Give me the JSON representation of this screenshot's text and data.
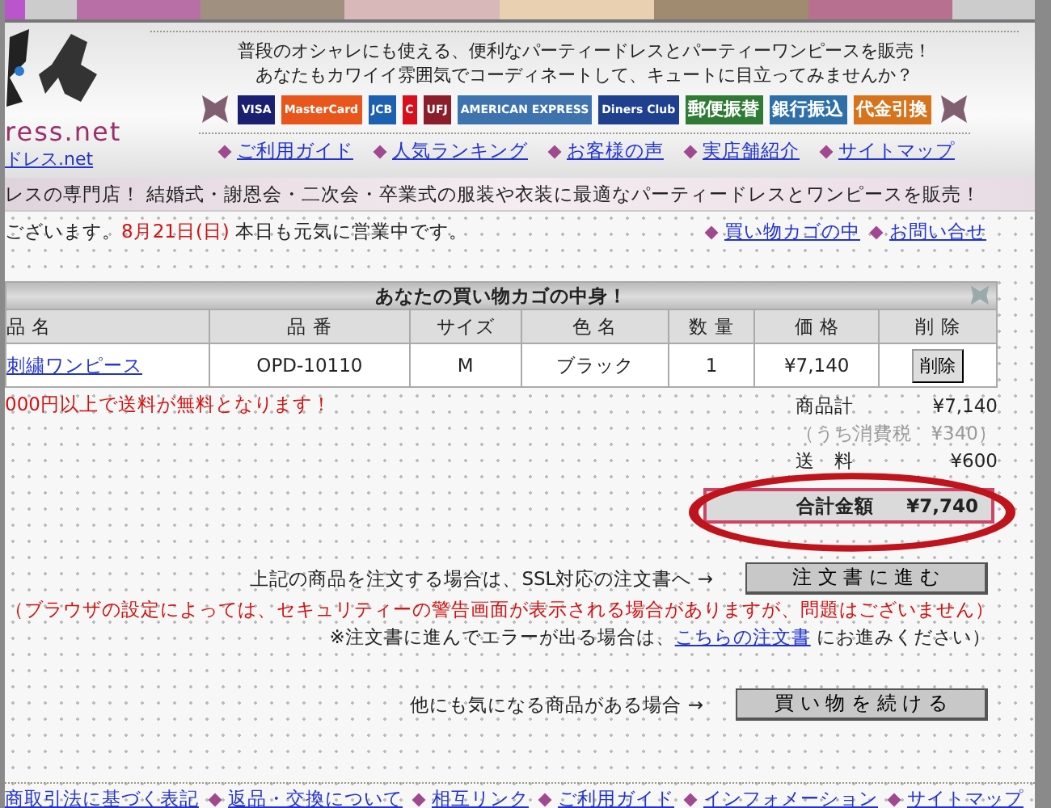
{
  "header": {
    "logo_text": "ress.net",
    "logo_link": "ドレス.net",
    "tagline_lines": [
      "普段のオシャレにも使える、便利なパーティードレスとパーティーワンピースを販売！",
      "あなたもカワイイ雰囲気でコーディネートして、キュートに目立ってみませんか？"
    ],
    "payment_badges": [
      {
        "label": "VISA",
        "color": "#1a1f71"
      },
      {
        "label": "MasterCard",
        "color": "#e8561c"
      },
      {
        "label": "JCB",
        "color": "#1d5fb0"
      },
      {
        "label": "C",
        "color": "#d8101c"
      },
      {
        "label": "UFJ",
        "color": "#8b1e2a"
      },
      {
        "label": "AMERICAN EXPRESS",
        "color": "#3f73b0"
      },
      {
        "label": "Diners Club",
        "color": "#1f3f8f"
      },
      {
        "label": "郵便振替",
        "color": "#2f7a34"
      },
      {
        "label": "銀行振込",
        "color": "#2f6fa8"
      },
      {
        "label": "代金引換",
        "color": "#d6731c"
      }
    ],
    "nav": [
      "ご利用ガイド",
      "人気ランキング",
      "お客様の声",
      "実店舗紹介",
      "サイトマップ"
    ]
  },
  "banner": "レスの専門店！ 結婚式・謝恩会・二次会・卒業式の服装や衣装に最適なパーティードレスとワンピースを販売！",
  "info": {
    "prefix": "ございます。",
    "date": "8月21日(日)",
    "suffix": "本日も元気に営業中です。",
    "links": [
      "買い物カゴの中",
      "お問い合せ"
    ]
  },
  "cart": {
    "title": "あなたの買い物カゴの中身！",
    "columns": [
      "品 名",
      "品 番",
      "サイズ",
      "色 名",
      "数 量",
      "価 格",
      "削 除"
    ],
    "rows": [
      {
        "name": "刺繍ワンピース",
        "code": "OPD-10110",
        "size": "M",
        "color_name": "ブラック",
        "qty": "1",
        "price": "¥7,140",
        "action": "削除"
      }
    ]
  },
  "shipping_notice": "000円以上で送料が無料となります！",
  "summary": [
    {
      "label": "商品計",
      "value": "¥7,140",
      "kind": "normal"
    },
    {
      "label": "（うち消費税",
      "value": "¥340）",
      "kind": "muted"
    },
    {
      "label": "送　料",
      "value": "¥600",
      "kind": "normal"
    }
  ],
  "total": {
    "label": "合計金額",
    "value": "¥7,740",
    "highlighted": true
  },
  "order": {
    "text": "上記の商品を注文する場合は、SSL対応の注文書へ →",
    "button": "注 文 書 に 進 む"
  },
  "ssl_warning": "（ブラウザの設定によっては、セキュリティーの警告画面が表示される場合がありますが、問題はございません）",
  "error_note": {
    "before": "※注文書に進んでエラーが出る場合は、",
    "link": "こちらの注文書",
    "after": "にお進みください）"
  },
  "continue": {
    "text": "他にも気になる商品がある場合 →",
    "button": "買 い 物 を 続 け る"
  },
  "footer_links": [
    "商取引法に基づく表記",
    "返品・交換について",
    "相互リンク",
    "ご利用ガイド",
    "インフォメーション",
    "サイトマップ"
  ]
}
